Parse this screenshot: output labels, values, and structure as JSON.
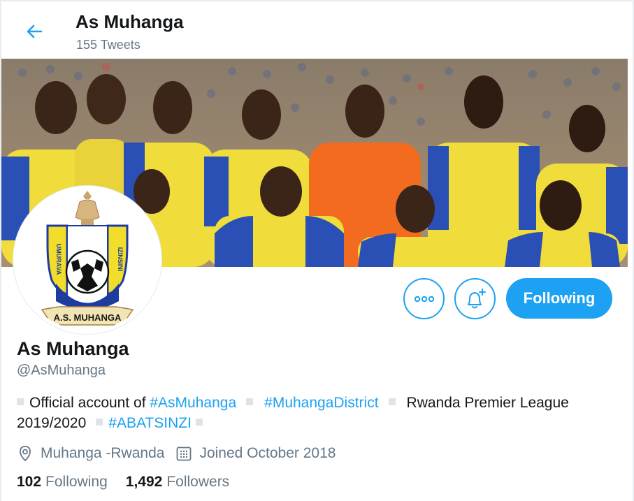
{
  "header": {
    "title": "As Muhanga",
    "tweet_count": "155 Tweets"
  },
  "avatar": {
    "logo_text_left": "UMURAVA",
    "logo_text_right": "IZINSINI",
    "logo_text_bottom": "A.S. MUHANGA"
  },
  "actions": {
    "more_icon": "more-horizontal-icon",
    "notify_icon": "bell-plus-icon",
    "follow_label": "Following"
  },
  "profile": {
    "name": "As Muhanga",
    "handle": "@AsMuhanga",
    "bio": {
      "part1": "Official account of ",
      "tag1": "#AsMuhanga",
      "tag2": "#MuhangaDistrict",
      "part2": "Rwanda Premier League 2019/2020",
      "tag3": "#ABATSINZI"
    },
    "location": "Muhanga -Rwanda",
    "joined": "Joined October 2018",
    "following_count": "102",
    "following_label": "Following",
    "followers_count": "1,492",
    "followers_label": "Followers"
  },
  "colors": {
    "accent": "#1da1f2",
    "muted": "#657786",
    "text": "#14171a"
  }
}
